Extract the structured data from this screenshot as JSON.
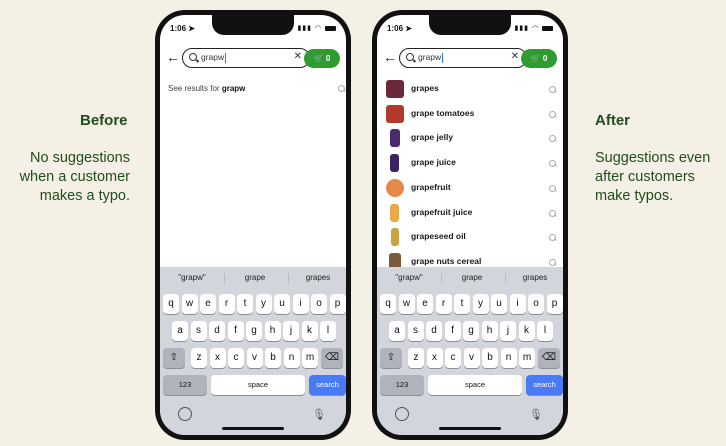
{
  "left_panel": {
    "title": "Before",
    "lines": [
      "No suggestions",
      "when a customer",
      "makes a typo."
    ]
  },
  "right_panel": {
    "title": "After",
    "lines": [
      "Suggestions even",
      "after customers",
      "make typos."
    ]
  },
  "phone": {
    "time": "1:06",
    "search_query": "grapw",
    "cart_count": "0",
    "clear_glyph": "✕",
    "back_glyph": "←"
  },
  "before_screen": {
    "see_results_prefix": "See results for",
    "see_results_query": "grapw"
  },
  "after_screen": {
    "suggestions": [
      {
        "label": "grapes",
        "thumb_color": "#6a2a3a"
      },
      {
        "label": "grape tomatoes",
        "thumb_color": "#b33a2a"
      },
      {
        "label": "grape jelly",
        "thumb_color": "#4b2a6e"
      },
      {
        "label": "grape juice",
        "thumb_color": "#3b2260"
      },
      {
        "label": "grapefruit",
        "thumb_color": "#e58a4a"
      },
      {
        "label": "grapefruit juice",
        "thumb_color": "#e8a94b"
      },
      {
        "label": "grapeseed oil",
        "thumb_color": "#c9a441"
      },
      {
        "label": "grape nuts cereal",
        "thumb_color": "#7a5a3a"
      }
    ]
  },
  "keyboard": {
    "predictions": [
      "\"grapw\"",
      "grape",
      "grapes"
    ],
    "row1": [
      "q",
      "w",
      "e",
      "r",
      "t",
      "y",
      "u",
      "i",
      "o",
      "p"
    ],
    "row2": [
      "a",
      "s",
      "d",
      "f",
      "g",
      "h",
      "j",
      "k",
      "l"
    ],
    "row3": [
      "z",
      "x",
      "c",
      "v",
      "b",
      "n",
      "m"
    ],
    "shift_glyph": "⇧",
    "delete_glyph": "⌫",
    "numbers_label": "123",
    "space_label": "space",
    "search_label": "search",
    "mic_glyph": "🎙"
  },
  "colors": {
    "accent_green": "#2e9c2e",
    "text_green": "#1f4d1d",
    "search_key_blue": "#4a7af5"
  }
}
